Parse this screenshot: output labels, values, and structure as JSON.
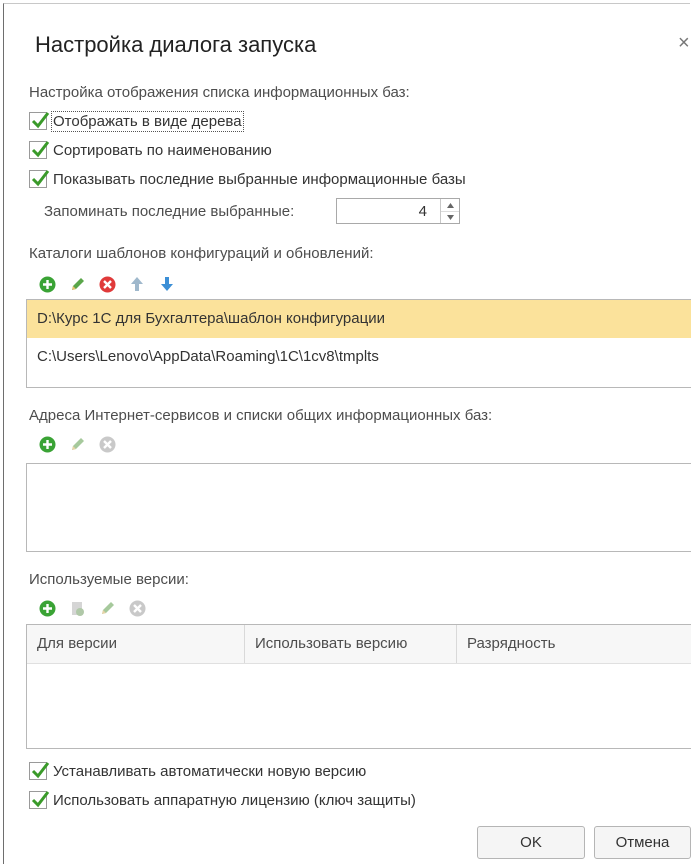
{
  "dialog": {
    "title": "Настройка диалога запуска",
    "close_glyph": "×"
  },
  "display_settings": {
    "heading": "Настройка отображения списка информационных баз:",
    "tree_view": {
      "label": "Отображать в виде дерева",
      "checked": true
    },
    "sort_by_name": {
      "label": "Сортировать по наименованию",
      "checked": true
    },
    "show_recent": {
      "label": "Показывать последние выбранные информационные базы",
      "checked": true
    },
    "remember_recent": {
      "label": "Запоминать последние выбранные:",
      "value": "4"
    }
  },
  "templates": {
    "heading": "Каталоги шаблонов конфигураций и обновлений:",
    "toolbar": [
      "add-icon",
      "edit-icon",
      "delete-icon",
      "move-up-icon",
      "move-down-icon"
    ],
    "items": [
      "D:\\Курс 1С для Бухгалтера\\шаблон конфигурации",
      "C:\\Users\\Lenovo\\AppData\\Roaming\\1C\\1cv8\\tmplts"
    ],
    "selected_index": 0
  },
  "internet_services": {
    "heading": "Адреса Интернет-сервисов и списки общих информационных баз:",
    "toolbar": [
      "add-icon",
      "edit-icon",
      "delete-icon"
    ]
  },
  "versions": {
    "heading": "Используемые версии:",
    "toolbar": [
      "add-icon",
      "copy-icon",
      "edit-icon",
      "delete-icon"
    ],
    "columns": [
      "Для версии",
      "Использовать версию",
      "Разрядность"
    ]
  },
  "options": {
    "auto_install": {
      "label": "Устанавливать автоматически новую версию",
      "checked": true
    },
    "hardware_license": {
      "label": "Использовать аппаратную лицензию (ключ защиты)",
      "checked": true
    }
  },
  "buttons": {
    "ok": "OK",
    "cancel": "Отмена"
  },
  "colors": {
    "selection": "#fbe29b",
    "check": "#3a9a2a",
    "add": "#3aa335",
    "delete": "#e03a3a",
    "arrow": "#3c8fd6"
  }
}
